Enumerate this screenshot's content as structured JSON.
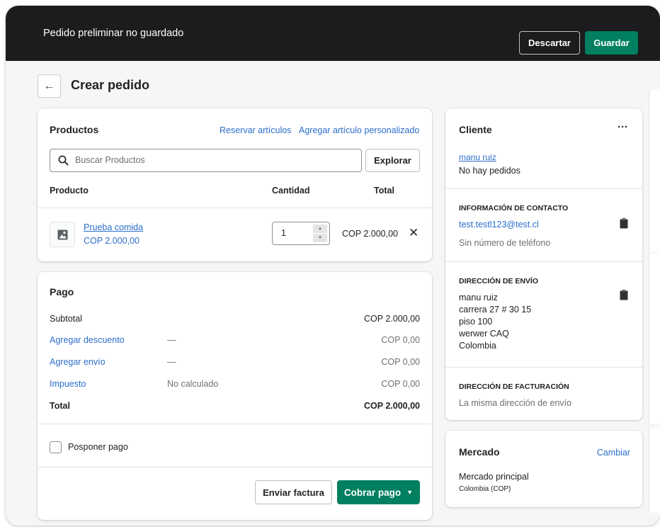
{
  "topbar": {
    "title": "Pedido preliminar no guardado",
    "discard_label": "Descartar",
    "save_label": "Guardar"
  },
  "page": {
    "title": "Crear pedido"
  },
  "products": {
    "heading": "Productos",
    "reserve_link": "Reservar artículos",
    "custom_link": "Agregar artículo personalizado",
    "search_placeholder": "Buscar Productos",
    "explore_label": "Explorar",
    "columns": {
      "product": "Producto",
      "quantity": "Cantidad",
      "total": "Total"
    },
    "item": {
      "name": "Prueba comida",
      "price": "COP 2.000,00",
      "quantity": "1",
      "total": "COP 2.000,00"
    }
  },
  "payment": {
    "heading": "Pago",
    "rows": [
      {
        "label": "Subtotal",
        "middle": "",
        "value": "COP 2.000,00"
      },
      {
        "label": "Agregar descuento",
        "middle": "—",
        "value": "COP 0,00"
      },
      {
        "label": "Agregar envío",
        "middle": "—",
        "value": "COP 0,00"
      },
      {
        "label": "Impuesto",
        "middle": "No calculado",
        "value": "COP 0,00"
      },
      {
        "label": "Total",
        "middle": "",
        "value": "COP 2.000,00"
      }
    ],
    "postpone_label": "Posponer pago",
    "invoice_label": "Enviar factura",
    "collect_label": "Cobrar pago"
  },
  "customer": {
    "heading": "Cliente",
    "more_label": "···",
    "name": "manu ruiz",
    "orders": "No hay pedidos",
    "contact_heading": "INFORMACIÓN DE CONTACTO",
    "email": "test.testl123@test.cl",
    "phone": "Sin número de teléfono",
    "shipping_heading": "DIRECCIÓN DE ENVÍO",
    "shipping_lines": [
      "manu ruiz",
      "carrera 27 # 30 15",
      "piso 100",
      "werwer CAQ",
      "Colombia"
    ],
    "billing_heading": "DIRECCIÓN DE FACTURACIÓN",
    "billing_text": "La misma dirección de envío"
  },
  "market": {
    "heading": "Mercado",
    "change_label": "Cambiar",
    "name": "Mercado principal",
    "detail": "Colombia (COP)"
  },
  "colors": {
    "primary": "#008060",
    "link": "#2c6ecb",
    "topbar": "#1a1c1d"
  },
  "icons": [
    "arrow-left-icon",
    "search-icon",
    "image-icon",
    "close-icon",
    "clipboard-icon",
    "caret-down-icon"
  ]
}
